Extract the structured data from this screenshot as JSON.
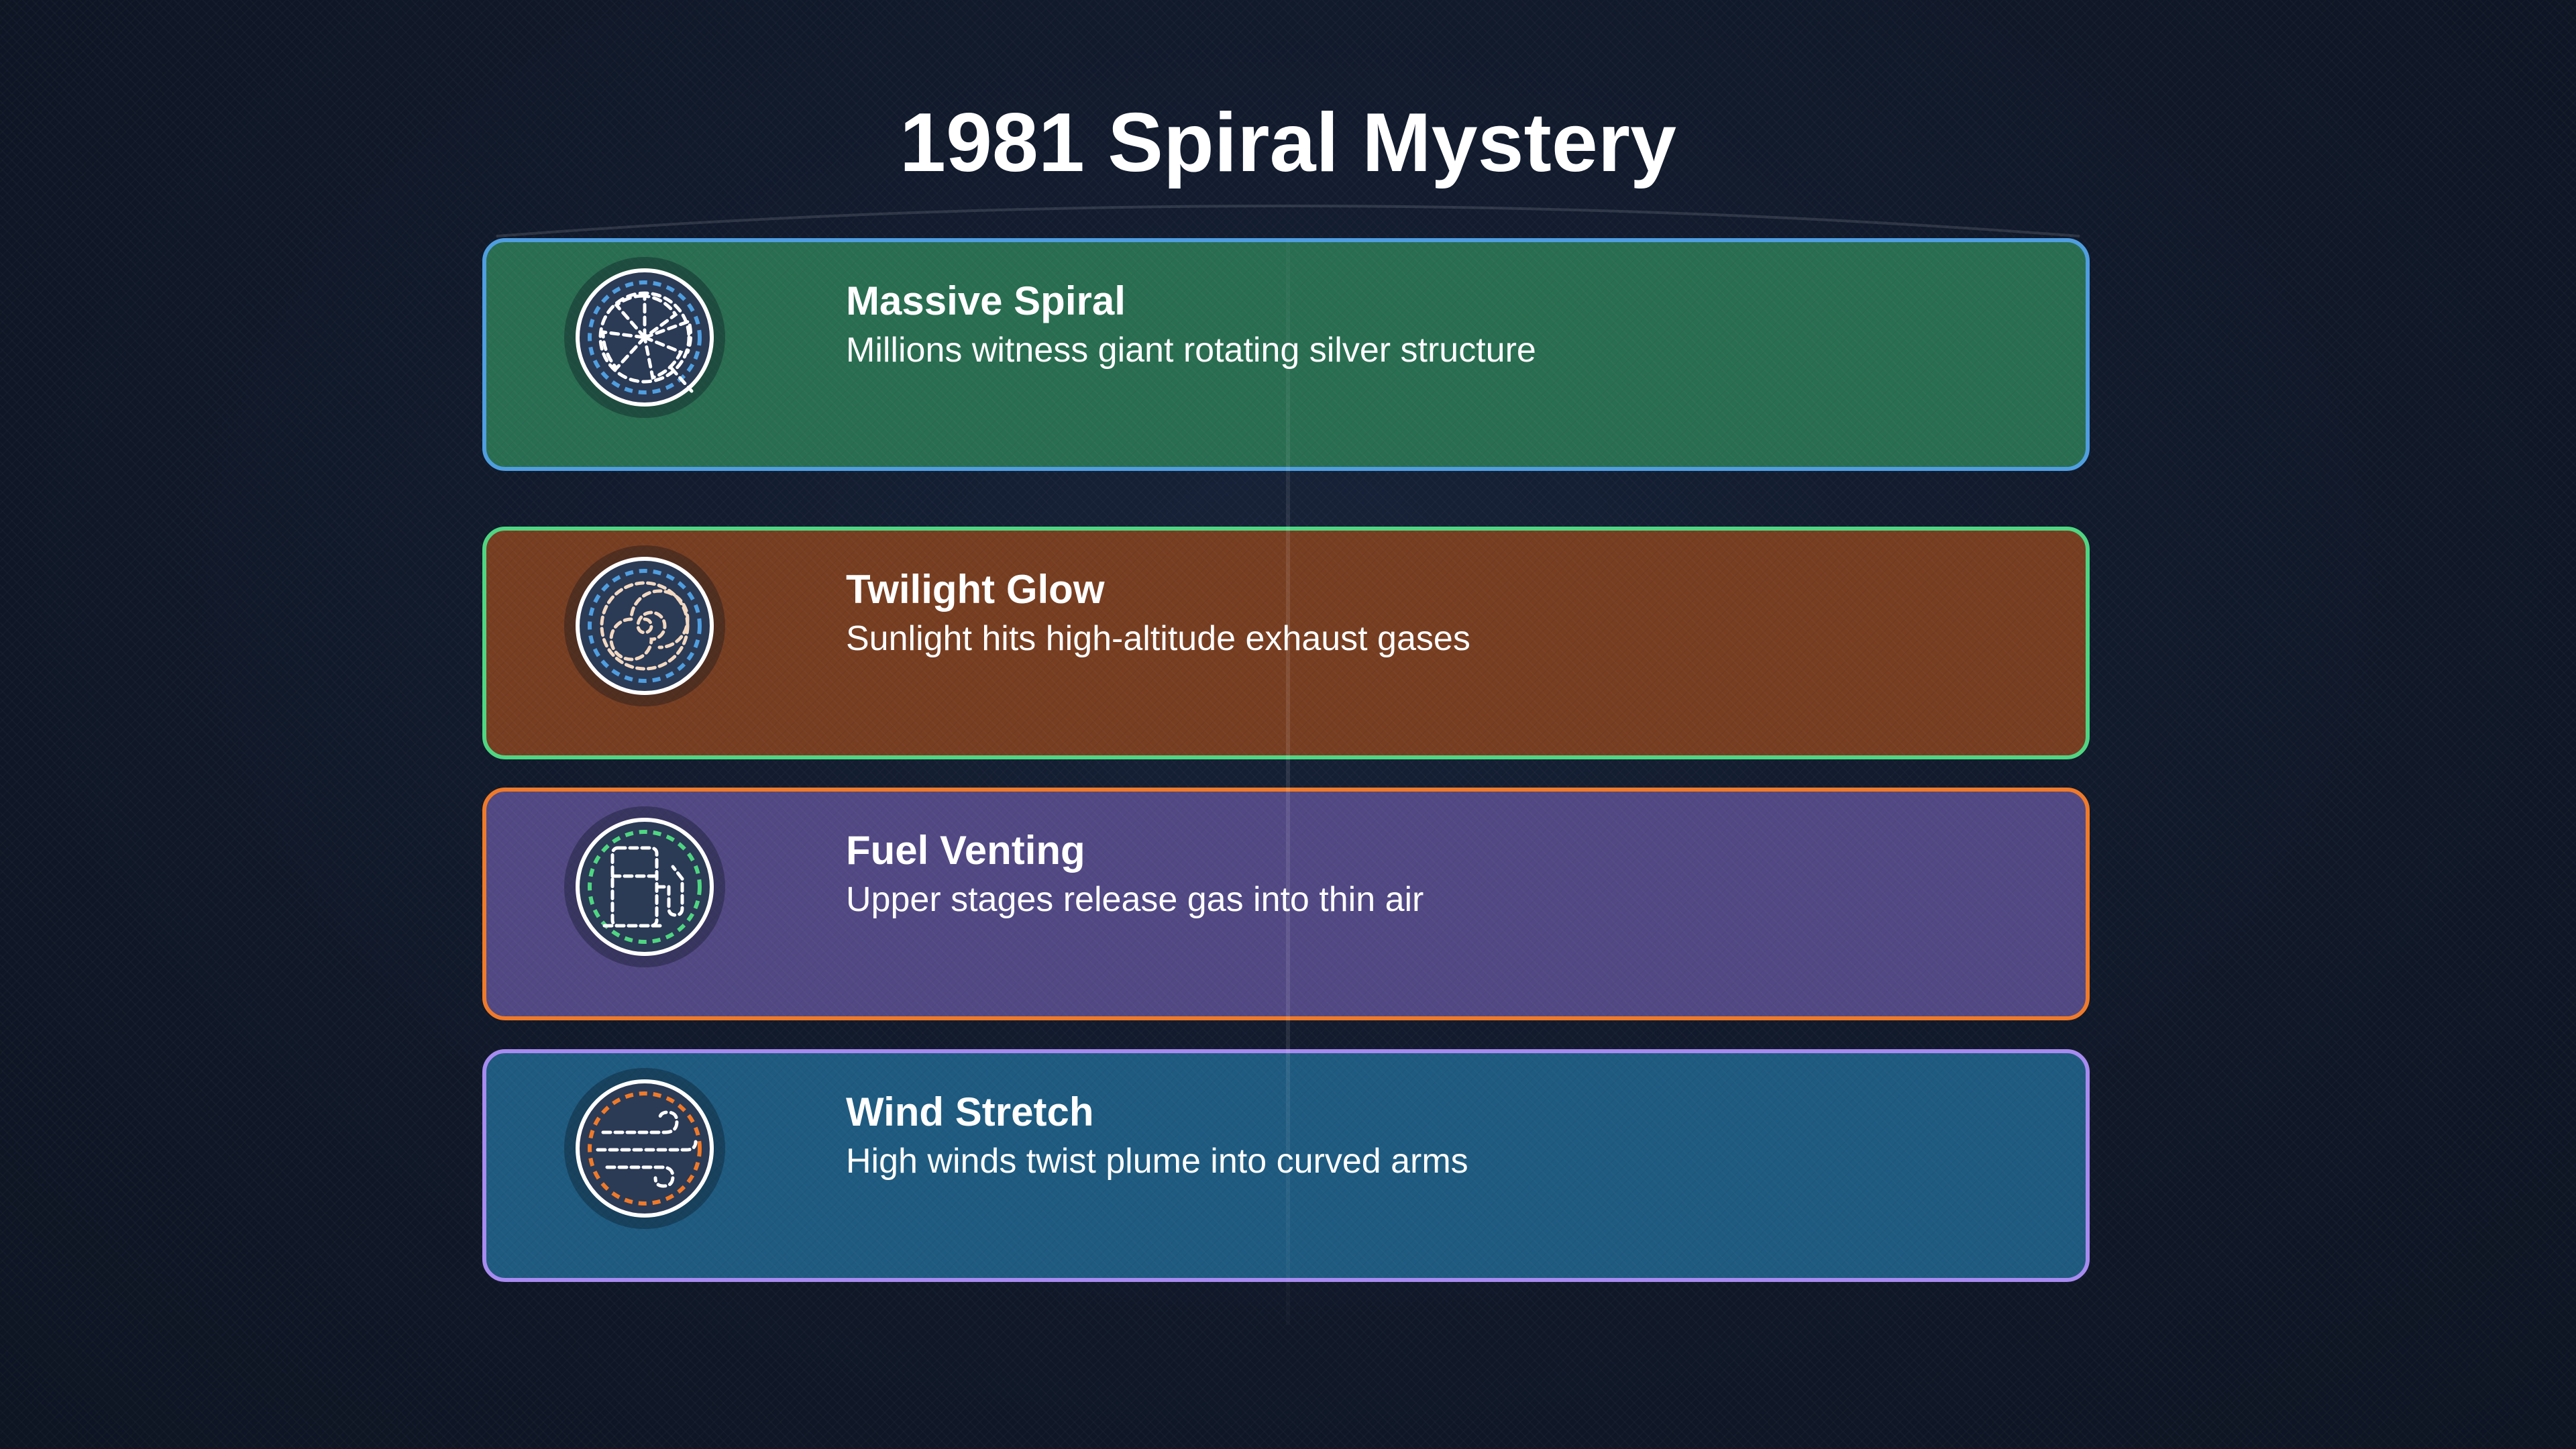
{
  "title": "1981 Spiral Mystery",
  "cards": [
    {
      "title": "Massive Spiral",
      "description": "Millions witness giant rotating silver structure",
      "icon": "spiral-fan-icon",
      "fill_color": "#2a6e52",
      "border_color": "#4f9ee0",
      "icon_ring_color": "#4f9ee0"
    },
    {
      "title": "Twilight Glow",
      "description": "Sunlight hits high-altitude exhaust gases",
      "icon": "concentric-spiral-icon",
      "fill_color": "#773e22",
      "border_color": "#4fd682",
      "icon_ring_color": "#4f9ee0"
    },
    {
      "title": "Fuel Venting",
      "description": "Upper stages release gas into thin air",
      "icon": "fuel-pump-icon",
      "fill_color": "#524984",
      "border_color": "#ef7a2a",
      "icon_ring_color": "#4fd682"
    },
    {
      "title": "Wind Stretch",
      "description": "High winds twist plume into curved arms",
      "icon": "wind-icon",
      "fill_color": "#1f5b80",
      "border_color": "#a78bf0",
      "icon_ring_color": "#ef7a2a"
    }
  ]
}
